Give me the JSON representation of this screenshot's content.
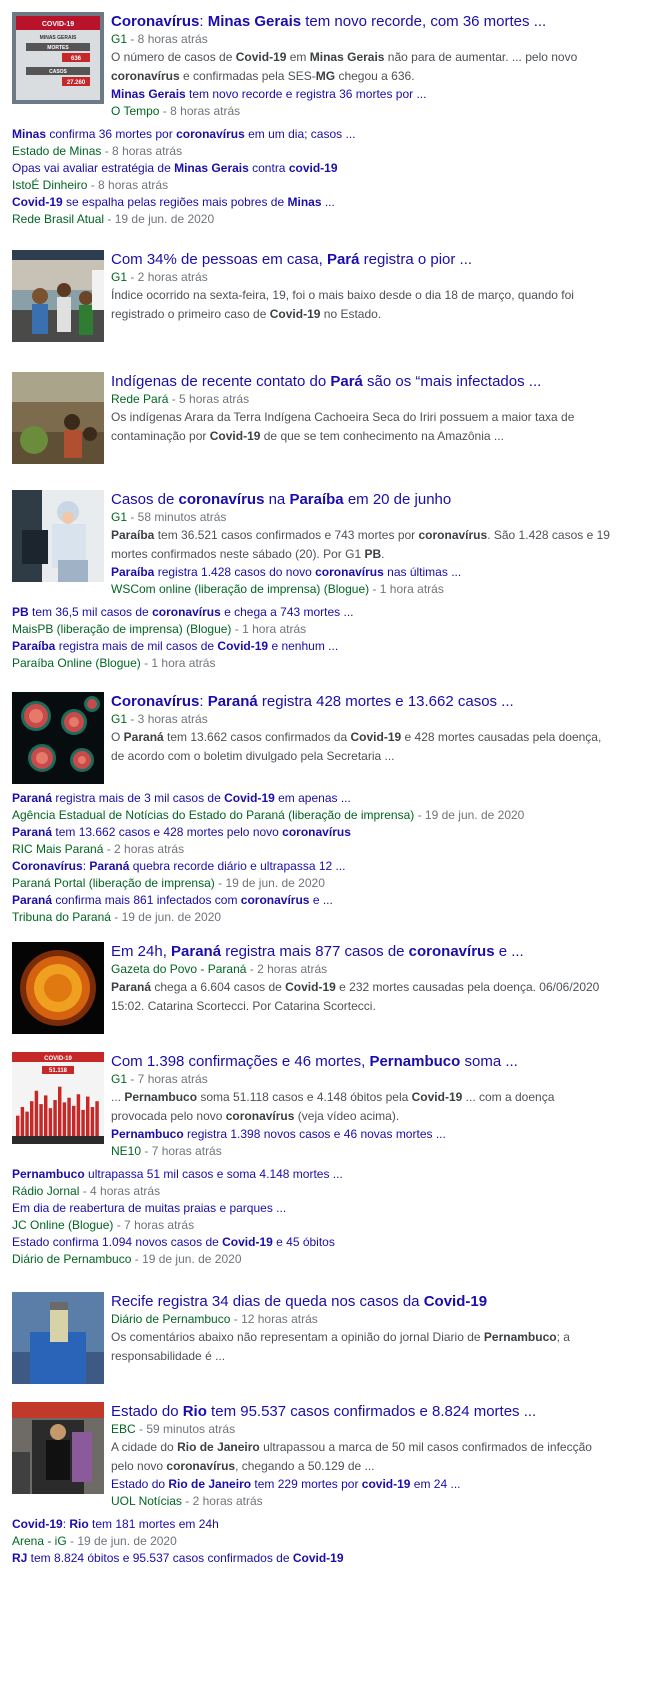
{
  "stories": [
    {
      "title_parts": [
        [
          "Coronavírus",
          true
        ],
        [
          ": ",
          false
        ],
        [
          "Minas Gerais",
          true
        ],
        [
          " tem novo recorde, com 36 mortes ...",
          false
        ]
      ],
      "source": "G1",
      "time": "8 horas atrás",
      "snippet_parts": [
        [
          "O número de casos de ",
          false
        ],
        [
          "Covid-19",
          true
        ],
        [
          " em ",
          false
        ],
        [
          "Minas Gerais",
          true
        ],
        [
          " não para de aumentar. ... pelo novo ",
          false
        ],
        [
          "coronavírus",
          true
        ],
        [
          " e confirmadas pela SES-",
          false
        ],
        [
          "MG",
          true
        ],
        [
          " chegou a 636.",
          false
        ]
      ],
      "thumb_icon": "covid-stats-tv-icon",
      "indented": [
        {
          "parts": [
            [
              "Minas Gerais",
              true
            ],
            [
              " tem novo recorde e registra 36 mortes por ...",
              false
            ]
          ],
          "source": "O Tempo",
          "time": "8 horas atrás"
        }
      ],
      "full": [
        {
          "parts": [
            [
              "Minas",
              true
            ],
            [
              " confirma 36 mortes por ",
              false
            ],
            [
              "coronavírus",
              true
            ],
            [
              " em um dia; casos ...",
              false
            ]
          ],
          "source": "Estado de Minas",
          "time": "8 horas atrás"
        },
        {
          "parts": [
            [
              "Opas vai avaliar estratégia de ",
              false
            ],
            [
              "Minas Gerais",
              true
            ],
            [
              " contra ",
              false
            ],
            [
              "covid-19",
              true
            ]
          ],
          "source": "IstoÉ Dinheiro",
          "time": "8 horas atrás"
        },
        {
          "parts": [
            [
              "Covid-19",
              true
            ],
            [
              " se espalha pelas regiões mais pobres de ",
              false
            ],
            [
              "Minas",
              true
            ],
            [
              " ...",
              false
            ]
          ],
          "source": "Rede Brasil Atual",
          "time": "19 de jun. de 2020"
        }
      ]
    },
    {
      "title_parts": [
        [
          "Com 34% de pessoas em casa, ",
          false
        ],
        [
          "Pará",
          true
        ],
        [
          " registra o pior ...",
          false
        ]
      ],
      "source": "G1",
      "time": "2 horas atrás",
      "snippet_parts": [
        [
          "Índice ocorrido na sexta-feira, 19, foi o mais baixo desde o dia 18 de março, quando foi registrado o primeiro caso de ",
          false
        ],
        [
          "Covid-19",
          true
        ],
        [
          " no Estado.",
          false
        ]
      ],
      "thumb_icon": "street-market-photo-icon",
      "indented": [],
      "full": []
    },
    {
      "title_parts": [
        [
          "Indígenas de recente contato do ",
          false
        ],
        [
          "Pará",
          true
        ],
        [
          " são os “mais infectados ...",
          false
        ]
      ],
      "source": "Rede Pará",
      "time": "5 horas atrás",
      "snippet_parts": [
        [
          "Os indígenas Arara da Terra Indígena Cachoeira Seca do Iriri possuem a maior taxa de contaminação por ",
          false
        ],
        [
          "Covid-19",
          true
        ],
        [
          " de que se tem conhecimento na Amazônia ...",
          false
        ]
      ],
      "thumb_icon": "indigenous-village-photo-icon",
      "indented": [],
      "full": []
    },
    {
      "title_parts": [
        [
          "Casos de ",
          false
        ],
        [
          "coronavírus",
          true
        ],
        [
          " na ",
          false
        ],
        [
          "Paraíba",
          true
        ],
        [
          " em 20 de junho",
          false
        ]
      ],
      "source": "G1",
      "time": "58 minutos atrás",
      "snippet_parts": [
        [
          "Paraíba",
          true
        ],
        [
          " tem 36.521 casos confirmados e 743 mortes por ",
          false
        ],
        [
          "coronavírus",
          true
        ],
        [
          ". São 1.428 casos e 19 mortes confirmados neste sábado (20). Por G1 ",
          false
        ],
        [
          "PB",
          true
        ],
        [
          ".",
          false
        ]
      ],
      "thumb_icon": "health-worker-photo-icon",
      "indented": [
        {
          "parts": [
            [
              "Paraíba",
              true
            ],
            [
              " registra 1.428 casos do novo ",
              false
            ],
            [
              "coronavírus",
              true
            ],
            [
              " nas últimas ...",
              false
            ]
          ],
          "source": "WSCom online (liberação de imprensa) (Blogue)",
          "time": "1 hora atrás"
        }
      ],
      "full": [
        {
          "parts": [
            [
              "PB",
              true
            ],
            [
              " tem 36,5 mil casos de ",
              false
            ],
            [
              "coronavírus",
              true
            ],
            [
              " e chega a 743 mortes ...",
              false
            ]
          ],
          "source": "MaisPB (liberação de imprensa) (Blogue)",
          "time": "1 hora atrás"
        },
        {
          "parts": [
            [
              "Paraíba",
              true
            ],
            [
              " registra mais de mil casos de ",
              false
            ],
            [
              "Covid-19",
              true
            ],
            [
              " e nenhum ...",
              false
            ]
          ],
          "source": "Paraíba Online (Blogue)",
          "time": "1 hora atrás"
        }
      ]
    },
    {
      "title_parts": [
        [
          "Coronavírus",
          true
        ],
        [
          ": ",
          false
        ],
        [
          "Paraná",
          true
        ],
        [
          " registra 428 mortes e 13.662 casos ...",
          false
        ]
      ],
      "source": "G1",
      "time": "3 horas atrás",
      "snippet_parts": [
        [
          "O ",
          false
        ],
        [
          "Paraná",
          true
        ],
        [
          " tem 13.662 casos confirmados da ",
          false
        ],
        [
          "Covid-19",
          true
        ],
        [
          " e 428 mortes causadas pela doença, de acordo com o boletim divulgado pela Secretaria ...",
          false
        ]
      ],
      "thumb_icon": "virus-particles-icon",
      "indented": [],
      "full": [
        {
          "parts": [
            [
              "Paraná",
              true
            ],
            [
              " registra mais de 3 mil casos de ",
              false
            ],
            [
              "Covid-19",
              true
            ],
            [
              " em apenas ...",
              false
            ]
          ],
          "source": "Agência Estadual de Notícias do Estado do Paraná (liberação de imprensa)",
          "time": "19 de jun. de 2020"
        },
        {
          "parts": [
            [
              "Paraná",
              true
            ],
            [
              " tem 13.662 casos e 428 mortes pelo novo ",
              false
            ],
            [
              "coronavírus",
              true
            ]
          ],
          "source": "RIC Mais Paraná",
          "time": "2 horas atrás"
        },
        {
          "parts": [
            [
              "Coronavírus",
              true
            ],
            [
              ": ",
              false
            ],
            [
              "Paraná",
              true
            ],
            [
              " quebra recorde diário e ultrapassa 12 ...",
              false
            ]
          ],
          "source": "Paraná Portal (liberação de imprensa)",
          "time": "19 de jun. de 2020"
        },
        {
          "parts": [
            [
              "Paraná",
              true
            ],
            [
              " confirma mais 861 infectados com ",
              false
            ],
            [
              "coronavírus",
              true
            ],
            [
              " e ...",
              false
            ]
          ],
          "source": "Tribuna do Paraná",
          "time": "19 de jun. de 2020"
        }
      ]
    },
    {
      "title_parts": [
        [
          "Em 24h, ",
          false
        ],
        [
          "Paraná",
          true
        ],
        [
          " registra mais 877 casos de ",
          false
        ],
        [
          "coronavírus",
          true
        ],
        [
          " e ...",
          false
        ]
      ],
      "source": "Gazeta do Povo - Paraná",
      "time": "2 horas atrás",
      "snippet_parts": [
        [
          "Paraná",
          true
        ],
        [
          " chega a 6.604 casos de ",
          false
        ],
        [
          "Covid-19",
          true
        ],
        [
          " e 232 mortes causadas pela doença. 06/06/2020 15:02. Catarina Scortecci. Por Catarina Scortecci.",
          false
        ]
      ],
      "thumb_icon": "coronavirus-sphere-icon",
      "indented": [],
      "full": []
    },
    {
      "title_parts": [
        [
          "Com 1.398 confirmações e 46 mortes, ",
          false
        ],
        [
          "Pernambuco",
          true
        ],
        [
          " soma ...",
          false
        ]
      ],
      "source": "G1",
      "time": "7 horas atrás",
      "snippet_parts": [
        [
          "... ",
          false
        ],
        [
          "Pernambuco",
          true
        ],
        [
          " soma 51.118 casos e 4.148 óbitos pela ",
          false
        ],
        [
          "Covid-19",
          true
        ],
        [
          " ... com a doença provocada pelo novo ",
          false
        ],
        [
          "coronavírus",
          true
        ],
        [
          " (veja vídeo acima).",
          false
        ]
      ],
      "thumb_icon": "cases-bar-chart-icon",
      "thumb_headline": "COVID-19",
      "thumb_value": "51.118",
      "thumb_bars": [
        0.35,
        0.5,
        0.42,
        0.6,
        0.78,
        0.55,
        0.7,
        0.48,
        0.62,
        0.85,
        0.58,
        0.66,
        0.52,
        0.72,
        0.45,
        0.68,
        0.5,
        0.6
      ],
      "indented": [
        {
          "parts": [
            [
              "Pernambuco",
              true
            ],
            [
              " registra 1.398 novos casos e 46 novas mortes ...",
              false
            ]
          ],
          "source": "NE10",
          "time": "7 horas atrás"
        }
      ],
      "full": [
        {
          "parts": [
            [
              "Pernambuco",
              true
            ],
            [
              " ultrapassa 51 mil casos e soma 4.148 mortes ...",
              false
            ]
          ],
          "source": "Rádio Jornal",
          "time": "4 horas atrás"
        },
        {
          "parts": [
            [
              "Em dia de reabertura de muitas praias e parques ...",
              false
            ]
          ],
          "source": "JC Online (Blogue)",
          "time": "7 horas atrás"
        },
        {
          "parts": [
            [
              "Estado confirma 1.094 novos casos de ",
              false
            ],
            [
              "Covid-19",
              true
            ],
            [
              " e 45 óbitos",
              false
            ]
          ],
          "source": "Diário de Pernambuco",
          "time": "19 de jun. de 2020"
        }
      ]
    },
    {
      "title_parts": [
        [
          "Recife registra 34 dias de queda nos casos da ",
          false
        ],
        [
          "Covid-19",
          true
        ]
      ],
      "source": "Diário de Pernambuco",
      "time": "12 horas atrás",
      "snippet_parts": [
        [
          "Os comentários abaixo não representam a opinião do jornal Diario de ",
          false
        ],
        [
          "Pernambuco",
          true
        ],
        [
          "; a responsabilidade é ...",
          false
        ]
      ],
      "thumb_icon": "test-tube-photo-icon",
      "indented": [],
      "full": []
    },
    {
      "title_parts": [
        [
          "Estado do ",
          false
        ],
        [
          "Rio",
          true
        ],
        [
          " tem 95.537 casos confirmados e 8.824 mortes ...",
          false
        ]
      ],
      "source": "EBC",
      "time": "59 minutos atrás",
      "snippet_parts": [
        [
          "A cidade do ",
          false
        ],
        [
          "Rio de Janeiro",
          true
        ],
        [
          " ultrapassou a marca de 50 mil casos confirmados de infecção pelo novo ",
          false
        ],
        [
          "coronavírus",
          true
        ],
        [
          ", chegando a 50.129 de ...",
          false
        ]
      ],
      "thumb_icon": "street-crowd-photo-icon",
      "indented": [
        {
          "parts": [
            [
              "Estado do ",
              false
            ],
            [
              "Rio de Janeiro",
              true
            ],
            [
              " tem 229 mortes por ",
              false
            ],
            [
              "covid-19",
              true
            ],
            [
              " em 24 ...",
              false
            ]
          ],
          "source": "UOL Notícias",
          "time": "2 horas atrás"
        }
      ],
      "full": [
        {
          "parts": [
            [
              "Covid-19",
              true
            ],
            [
              ": ",
              false
            ],
            [
              "Rio",
              true
            ],
            [
              " tem 181 mortes em 24h",
              false
            ]
          ],
          "source": "Arena - iG",
          "time": "19 de jun. de 2020"
        },
        {
          "parts": [
            [
              "RJ",
              true
            ],
            [
              " tem 8.824 óbitos e 95.537 casos confirmados de ",
              false
            ],
            [
              "Covid-19",
              true
            ]
          ],
          "source": "",
          "time": ""
        }
      ]
    }
  ],
  "thumb1_text": {
    "header": "COVID-19",
    "sub": "MINAS GERAIS",
    "label1": "MORTES",
    "val1": "636",
    "label2": "CASOS",
    "val2": "27.260"
  }
}
